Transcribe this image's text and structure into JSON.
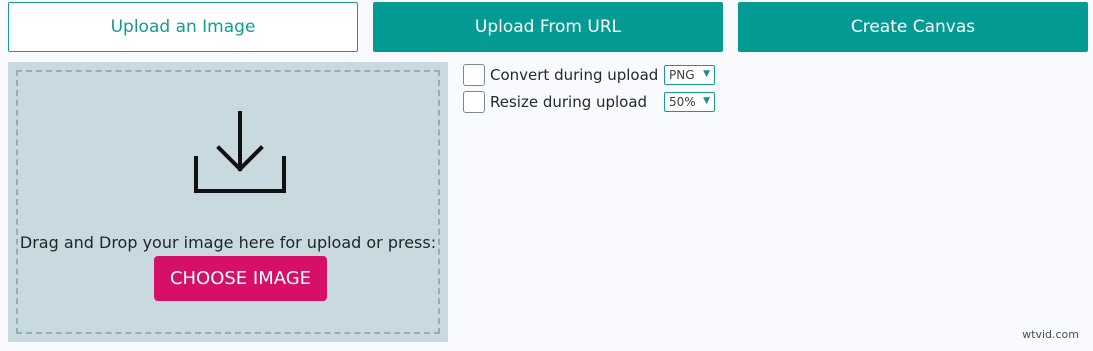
{
  "tabs": {
    "upload_image": "Upload an Image",
    "upload_url": "Upload From URL",
    "create_canvas": "Create Canvas"
  },
  "dropzone": {
    "icon": "download-icon",
    "text": "Drag and Drop your image here for upload or press:",
    "button_label": "CHOOSE IMAGE"
  },
  "options": [
    {
      "label": "Convert during upload",
      "checked": false,
      "select_value": "PNG"
    },
    {
      "label": "Resize during upload",
      "checked": false,
      "select_value": "50%"
    }
  ],
  "watermark": "wtvid.com",
  "colors": {
    "accent": "#059b95",
    "choose_button": "#d60f67",
    "dropzone_bg": "#c8d9e0"
  }
}
